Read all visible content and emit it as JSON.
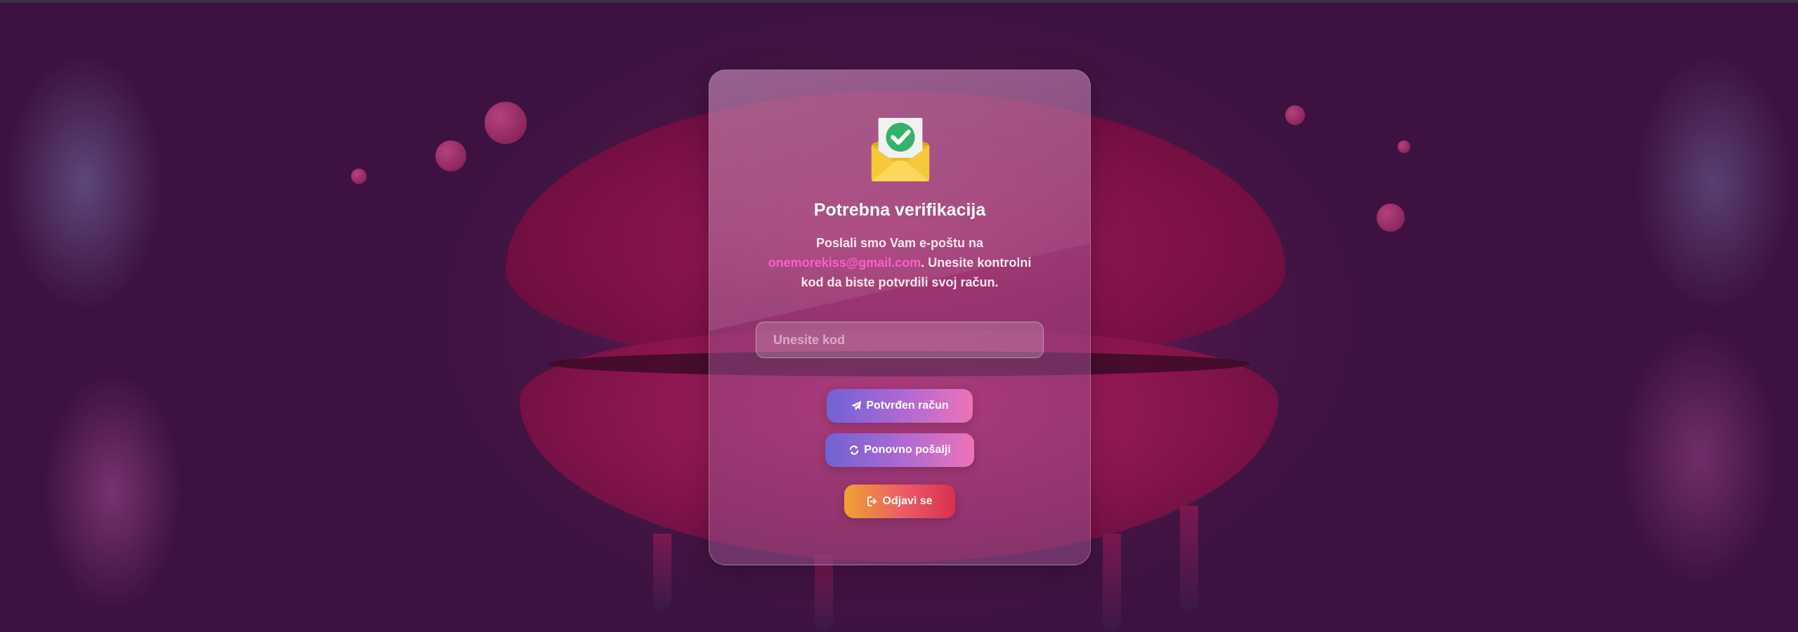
{
  "card": {
    "icon": "envelope-check-icon",
    "title": "Potrebna verifikacija",
    "message_before": "Poslali smo Vam e-poštu na",
    "email": "onemorekiss@gmail.com",
    "message_after": ". Unesite kontrolni kod da biste potvrdili svoj račun.",
    "code_input": {
      "value": "",
      "placeholder": "Unesite kod"
    },
    "buttons": {
      "verify": {
        "label": "Potvrđen račun",
        "icon": "paper-plane-icon"
      },
      "resend": {
        "label": "Ponovno pošalji",
        "icon": "refresh-icon"
      },
      "logout": {
        "label": "Odjavi se",
        "icon": "sign-out-icon"
      }
    }
  },
  "colors": {
    "email_link": "#ff5fc7",
    "primary_gradient": [
      "#6f63d4",
      "#ee73b8"
    ],
    "logout_gradient": [
      "#f0a234",
      "#d9304f"
    ]
  }
}
